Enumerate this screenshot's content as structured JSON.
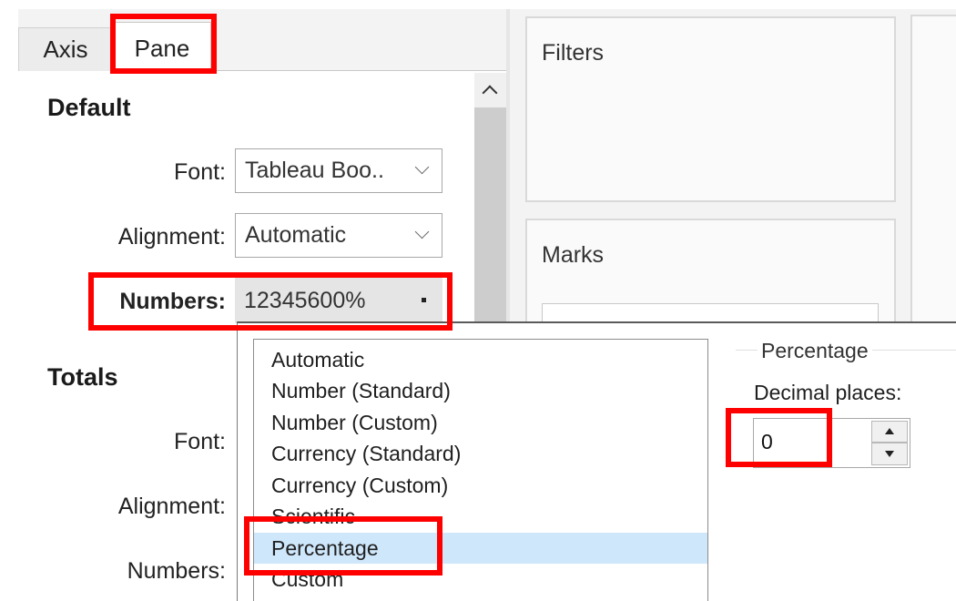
{
  "tabs": [
    {
      "label": "Axis",
      "active": false
    },
    {
      "label": "Pane",
      "active": true
    }
  ],
  "default_section": {
    "title": "Default",
    "font": {
      "label": "Font:",
      "value": "Tableau Boo.."
    },
    "alignment": {
      "label": "Alignment:",
      "value": "Automatic"
    },
    "numbers": {
      "label": "Numbers:",
      "value": "12345600%"
    }
  },
  "totals_section": {
    "title": "Totals",
    "font_label": "Font:",
    "alignment_label": "Alignment:",
    "numbers_label": "Numbers:"
  },
  "shelves": {
    "filters_title": "Filters",
    "marks_title": "Marks"
  },
  "number_format_list": {
    "items": [
      "Automatic",
      "Number (Standard)",
      "Number (Custom)",
      "Currency (Standard)",
      "Currency (Custom)",
      "Scientific",
      "Percentage",
      "Custom"
    ],
    "selected": "Percentage"
  },
  "percentage_options": {
    "group_title": "Percentage",
    "decimal_label": "Decimal places:",
    "decimal_value": "0"
  },
  "colors": {
    "highlight": "#ff0000",
    "selection": "#cfe7fb"
  }
}
